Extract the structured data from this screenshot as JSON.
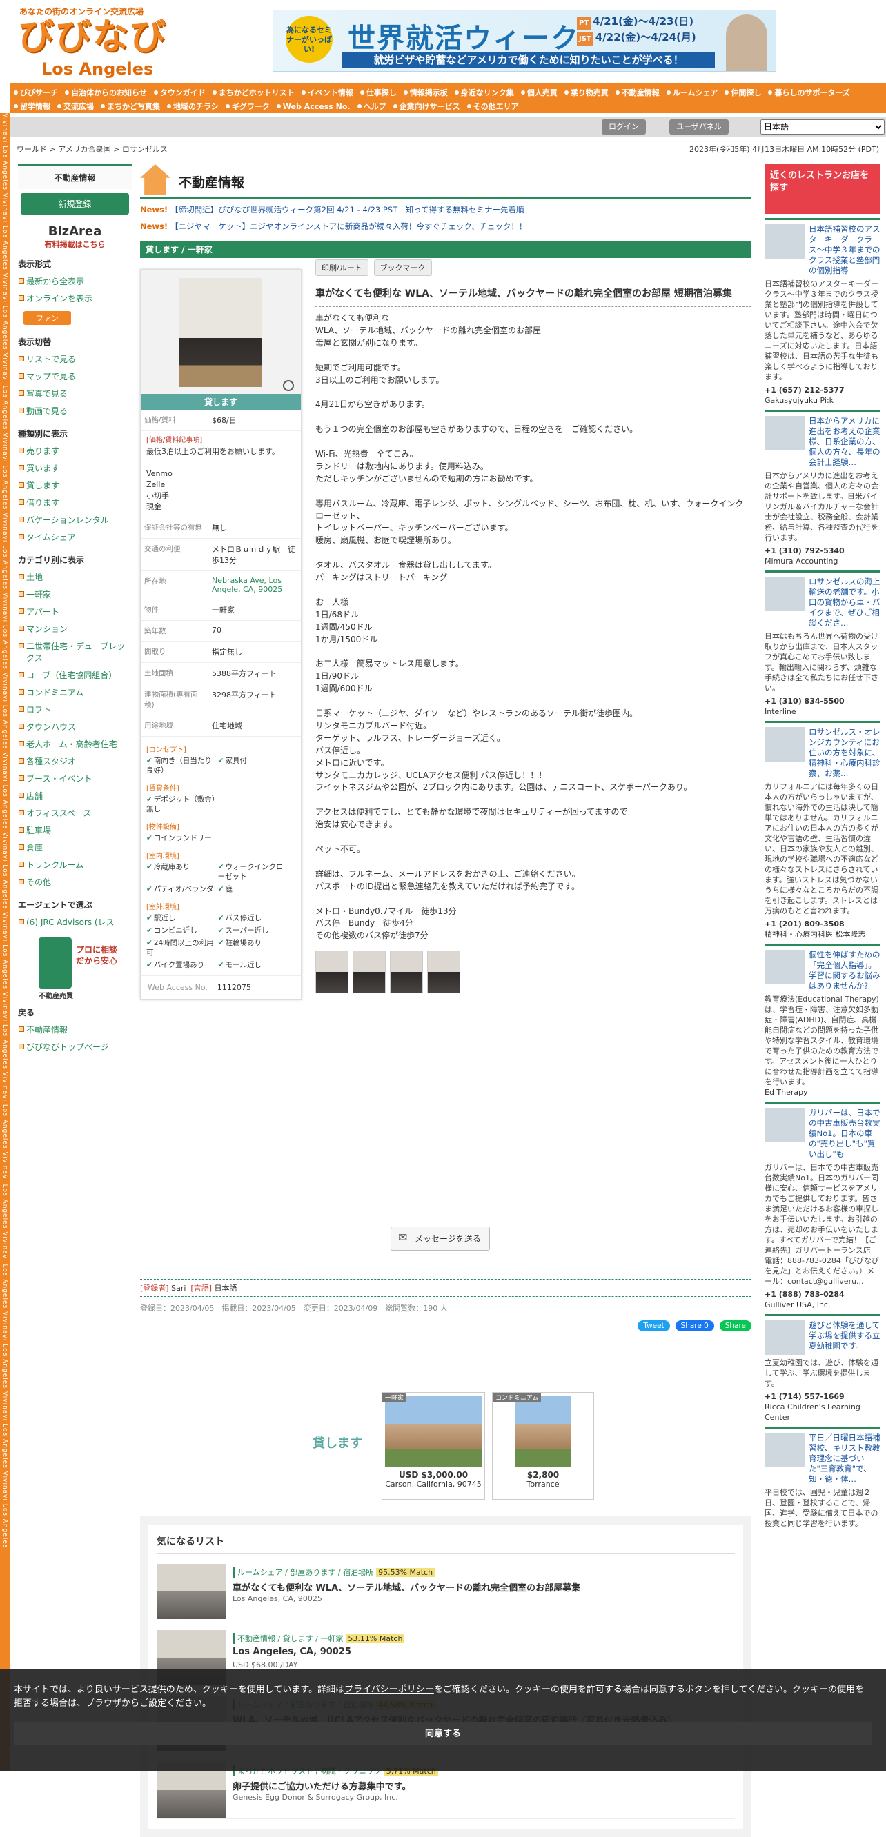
{
  "header": {
    "tagline": "あなたの街のオンライン交流広場",
    "logo": "びびなび",
    "city": "Los Angeles",
    "banner": {
      "bubble": "為になるセミナーがいっぱい!",
      "title": "世界就活ウィーク",
      "pt_label": "PT",
      "pt_dates": "4/21(金)〜4/23(日)",
      "jst_label": "JST",
      "jst_dates": "4/22(金)〜4/24(月)",
      "subtitle": "就労ビザや貯蓄などアメリカで働くために知りたいことが学べる！"
    }
  },
  "nav": [
    "びびサーチ",
    "自治体からのお知らせ",
    "タウンガイド",
    "まちかどホットリスト",
    "イベント情報",
    "仕事探し",
    "情報掲示板",
    "身近なリンク集",
    "個人売買",
    "乗り物売買",
    "不動産情報",
    "ルームシェア",
    "仲間探し",
    "暮らしのサポーターズ",
    "留学情報",
    "交流広場",
    "まちかど写真集",
    "地域のチラシ",
    "ギグワーク",
    "Web Access No.",
    "ヘルプ",
    "企業向けサービス",
    "その他エリア"
  ],
  "toolbar": {
    "login": "ログイン",
    "user_panel": "ユーザパネル",
    "language": "日本語"
  },
  "breadcrumb": "ワールド > アメリカ合衆国 > ロサンゼルス",
  "datetime": "2023年(令和5年) 4月13日木曜日 AM 10時52分 (PDT)",
  "strip_text": "Vivinavi Los Angeles Vivinavi Los Angeles Vivinavi Los Angeles Vivinavi Los Angeles Vivinavi Los Angeles Vivinavi Los Angeles Vivinavi Los Angeles Vivinavi Los Angeles Vivinavi Los Angeles Vivinavi Los Angeles Vivinavi Los Angeles Vivinavi Los Angeles Vivinavi Los Angeles Vivinavi Los Angeles Vivinavi Los Angeles Vivinavi Los Angeles Vivinavi Los Angeles Vivinavi Los Angeles",
  "left": {
    "cat_head": "不動産情報",
    "new_btn": "新規登録",
    "bizarea": "BizArea",
    "bizarea_sub": "有料掲載はこちら",
    "display_title": "表示形式",
    "display": [
      "最新から全表示",
      "オンラインを表示"
    ],
    "fan": "ファン",
    "switch_title": "表示切替",
    "switch": [
      "リストで見る",
      "マップで見る",
      "写真で見る",
      "動画で見る"
    ],
    "kind_title": "種類別に表示",
    "kind": [
      "売ります",
      "買います",
      "貸します",
      "借ります",
      "バケーションレンタル",
      "タイムシェア"
    ],
    "category_title": "カテゴリ別に表示",
    "category": [
      "土地",
      "一軒家",
      "アパート",
      "マンション",
      "二世帯住宅・デュープレックス",
      "コープ（住宅協同組合）",
      "コンドミニアム",
      "ロフト",
      "タウンハウス",
      "老人ホーム・高齢者住宅",
      "各種スタジオ",
      "ブース・イベント",
      "店舗",
      "オフィススペース",
      "駐車場",
      "倉庫",
      "トランクルーム",
      "その他"
    ],
    "agent_title": "エージェントで選ぶ",
    "agent": [
      "(6) JRC Advisors (レス"
    ],
    "pro": "プロに相談だから安心",
    "pro_label": "不動産売買",
    "back_title": "戻る",
    "back": [
      "不動産情報",
      "びびなびトップページ"
    ]
  },
  "main": {
    "title": "不動産情報",
    "news": [
      {
        "tag": "News!",
        "text": "【締切間近】びびなび世界就活ウィーク第2回 4/21 - 4/23 PST　知って得する無料セミナー先着順"
      },
      {
        "tag": "News!",
        "text": "【ニジヤマーケット】ニジヤオンラインストアに新商品が続々入荷！今すぐチェック、チェック！！"
      }
    ],
    "listing_head": "貸します / 一軒家",
    "type_bar": "貸します",
    "info": [
      {
        "k": "価格/賃料",
        "v": "$68/日"
      },
      {
        "k": "保証会社等の有無",
        "v": "無し"
      },
      {
        "k": "交通の利便",
        "v": "メトロＢｕｎｄｙ駅　徒歩13分"
      },
      {
        "k": "所在地",
        "v": "Nebraska Ave, Los Angele, CA, 90025"
      },
      {
        "k": "物件",
        "v": "一軒家"
      },
      {
        "k": "築年数",
        "v": "70"
      },
      {
        "k": "間取り",
        "v": "指定無し"
      },
      {
        "k": "土地面積",
        "v": "5388平方フィート"
      },
      {
        "k": "建物面積(専有面積)",
        "v": "3298平方フィート"
      },
      {
        "k": "用途地域",
        "v": "住宅地域"
      }
    ],
    "price_note_title": "[価格/賃料記事項]",
    "price_note": "最低3泊以上のご利用をお願いします。\n\nVenmo\nZelle\n小切手\n現金",
    "concept_title": "[コンセプト]",
    "concept": [
      "南向き（日当たり良好）",
      "家具付"
    ],
    "rent_title": "[賃貸条件]",
    "rent": [
      "デポジット（敷金）無し"
    ],
    "facility_title": "[物件設備]",
    "facility": [
      "コインランドリー"
    ],
    "indoor_title": "[室内環境]",
    "indoor": [
      "冷蔵庫あり",
      "ウォークインクローゼット",
      "パティオ/ベランダ",
      "庭"
    ],
    "outdoor_title": "[室外環境]",
    "outdoor": [
      "駅近し",
      "バス停近し",
      "コンビニ近し",
      "スーパー近し",
      "24時間以上の利用可",
      "駐輪場あり",
      "バイク置場あり",
      "モール近し"
    ],
    "web_access_label": "Web Access No.",
    "web_access": "1112075",
    "print_btn": "印刷/ルート",
    "bookmark_btn": "ブックマーク",
    "heading": "車がなくても便利な WLA、ソーテル地域、バックヤードの離れ完全個室のお部屋 短期宿泊募集",
    "description": "車がなくても便利な\nWLA、ソーテル地域、バックヤードの離れ完全個室のお部屋\n母屋と玄関が別になります。\n\n短期でご利用可能です。\n3日以上のご利用でお願いします。\n\n4月21日から空きがあります。\n\nもう１つの完全個室のお部屋も空きがありますので、日程の空きを　ご確認ください。\n\nWi-Fi、光熱費　全てこみ。\nランドリーは敷地内にあります。使用料込み。\nただしキッチンがございませんので短期の方にお勧めです。\n\n専用バスルーム、冷蔵庫、電子レンジ、ポット、シングルベッド、シーツ、お布団、枕、机、いす、ウォークインクローゼット、\nトイレットペーパー、キッチンペーパーございます。\n暖房、扇風機、お庭で喫煙場所あり。\n\nタオル、バスタオル　食器は貸し出ししてます。\nパーキングはストリートパーキング\n\nお一人様\n1日/68ドル\n1週間/450ドル\n1か月/1500ドル\n\nお二人様　簡易マットレス用意します。\n1日/90ドル\n1週間/600ドル\n\n日系マーケット（ニジヤ、ダイソーなど）やレストランのあるソーテル街が徒歩圏内。\nサンタモニカブルバード付近。\nターゲット、ラルフス、トレーダージョーズ近く。\nバス停近し。\nメトロに近いです。\nサンタモニカカレッジ、UCLAアクセス便利 バス停近し！！！\nフイットネスジムや公園が、2ブロック内にあります。公園は、テニスコート、スケボーパークあり。\n\nアクセスは便利ですし、とても静かな環境で夜間はセキュリティーが回ってますので\n治安は安心できます。\n\nペット不可。\n\n詳細は、フルネーム、メールアドレスをおかきの上、ご連絡ください。\nパスポートのID提出と緊急連絡先を教えていただければ予約完了です。\n\nメトロ・Bundy0.7マイル　徒歩13分\nバス停　Bundy　徒歩4分\nその他複数のバス停が徒歩7分",
    "message_btn": "メッセージを送る",
    "poster_label": "[登録者]",
    "poster": "Sari",
    "lang_label": "[言語]",
    "lang": "日本語",
    "stats": "登録日：2023/04/05　掲載日：2023/04/05　変更日：2023/04/09　総閲覧数：190 人",
    "share": {
      "tweet": "Tweet",
      "fb": "Share 0",
      "line": "Share"
    },
    "related_label": "貸します",
    "related": [
      {
        "badge": "一軒家",
        "price": "USD $3,000.00",
        "place": "Carson, California, 90745"
      },
      {
        "badge": "コンドミニアム",
        "price": "$2,800",
        "place": "Torrance"
      }
    ],
    "interest_title": "気になるリスト",
    "interest": [
      {
        "cat": "ルームシェア / 部屋あります / 宿泊場所",
        "match": "95.53% Match",
        "title": "車がなくても便利な WLA、ソーテル地域、バックヤードの離れ完全個室のお部屋募集",
        "sub": "Los Angeles, CA, 90025"
      },
      {
        "cat": "不動産情報 / 貸します / 一軒家",
        "match": "53.11% Match",
        "title": "Los Angeles, CA, 90025",
        "sub": "USD $68.00 /DAY"
      },
      {
        "cat": "ルームシェア / 部屋あります / 宿泊場所",
        "match": "44.58% Match",
        "title": "WLA、ソーテル地域、UCLAアクセス便利なバックヤードの離れ完全個室の宿泊場所（家具付き光熱費込み）",
        "sub": "Los Angeles (West Los Angeles), California, 90025-9998"
      },
      {
        "cat": "まちかどホットリスト / 病院・クリニック",
        "match": "5.71% Match",
        "title": "卵子提供にご協力いただける方募集中です。",
        "sub": "Genesis Egg Donor & Surrogacy Group, Inc."
      }
    ]
  },
  "right": {
    "restaurant": "近くのレストランお店を探す",
    "ads": [
      {
        "head": "日本語補習校のアスターキーダークラス〜中学３年までのクラス授業と塾部門の個別指導",
        "body": "日本語補習校のアスターキーダークラス～中学３年までのクラス授業と塾部門の個別指導を併設しています。塾部門は時間・曜日についてご相談下さい。途中入会で欠落した単元を補うなど、あらゆるニーズに対応いたします。日本語補習校は、日本語の苦手な生徒も楽しく学べるように指導しております。",
        "tel": "+1 (657) 212-5377",
        "org": "Gakusyujyuku Pi:k"
      },
      {
        "head": "日本からアメリカに進出をお考えの企業様、日系企業の方、個人の方々、長年の会計士経験…",
        "body": "日本からアメリカに進出をお考えの企業や自営業、個人の方々の会計サポートを致します。日米バイリンガル＆バイカルチャーな会計士が会社設立、税務全般、会計業務、給与計算、各種監査の代行を行います。",
        "tel": "+1 (310) 792-5340",
        "org": "Mimura Accounting"
      },
      {
        "head": "ロサンゼルスの海上輸送の老舗です。小口の貨物から車・バイクまで、ぜひご相談くださ…",
        "body": "日本はもちろん世界へ荷物の受け取りから出庫まで、日本人スタッフが真心こめてお手伝い致します。輸出輸入に関わらず、煩雑な手続きは全て私たちにお任せ下さい。",
        "tel": "+1 (310) 834-5500",
        "org": "Interline"
      },
      {
        "head": "ロサンゼルス・オレンジカウンティにお住いの方を対象に、精神科・心療内科診察、お薬…",
        "body": "カリフォルニアには毎年多くの日本人の方がいらっしゃいますが、慣れない海外での生活は決して簡単ではありません。カリフォルニアにお住いの日本人の方の多くが文化や言語の壁、生活習慣の違い、日本の家族や友人との離別、現地の学校や職場への不適応などの様々なストレスにさらされています。強いストレスは気づかないうちに様々なところからだの不調を引き起こします。ストレスとは万病のもとと言われます。",
        "tel": "+1 (201) 809-3508",
        "org": "精神科・心療内科医 松本隆志"
      },
      {
        "head": "個性を伸ばすための「完全個人指導」。学習に関するお悩みはありませんか?",
        "body": "教育療法(Educational Therapy)は、学習症・障害、注意欠如多動症・障害(ADHD)、自閉症、高機能自閉症などの問題を持った子供や特別な学習スタイル、教育環境で育った子供のための教育方法です。アセスメント後に一人ひとりに合わせた指導計画を立てて指導を行います。",
        "tel": "",
        "org": "Ed Therapy"
      },
      {
        "head": "ガリバーは、日本での中古車販売台数実績No1。日本の車の\"売り出し\"も\"買い出し\"も",
        "body": "ガリバーは、日本での中古車販売台数実績No1。日本のガリバー同様に安心、信頼サービスをアメリカでもご提供しております。皆さま満足いただけるお客様の車探しをお手伝いいたします。お引越の方は、売却のお手伝いをいたします。すべてガリバーで完結！【ご連絡先】ガリバートーランス店　電話：888-783-0284「びびなびを見た」とお伝えください。）メール：contact@gulliveru...",
        "tel": "+1 (888) 783-0284",
        "org": "Gulliver USA, Inc."
      },
      {
        "head": "遊びと体験を通して学ぶ場を提供する立夏幼稚園です。",
        "body": "立夏幼稚園では、遊び、体験を通して学ぶ、学ぶ環境を提供します。",
        "tel": "+1 (714) 557-1669",
        "org": "Ricca Children's Learning Center"
      },
      {
        "head": "平日／日曜日本語補習校、キリスト教教育理念に基づいた\"三育教育\"で、知・徳・体…",
        "body": "平日校では、園児・児童は週２日、登園・登校することで、帰国、進学、受験に備えて日本での授業と同じ学習を行います。",
        "tel": "",
        "org": ""
      }
    ]
  },
  "cookie": {
    "text_before": "本サイトでは、より良いサービス提供のため、クッキーを使用しています。詳細は",
    "policy_link": "プライバシーポリシー",
    "text_after": "をご確認ください。クッキーの使用を許可する場合は同意するボタンを押してください。クッキーの使用を拒否する場合は、ブラウザからご設定ください。",
    "agree": "同意する"
  }
}
